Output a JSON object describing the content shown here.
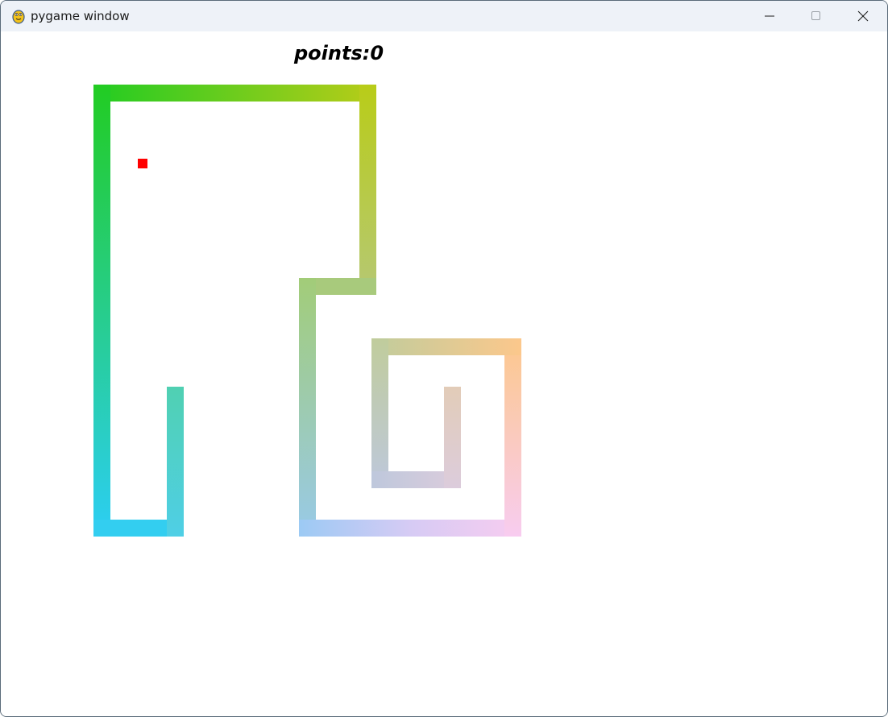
{
  "window": {
    "title": "pygame window",
    "icon": "pygame-snake-icon",
    "controls": [
      "minimize-icon",
      "maximize-icon",
      "close-icon"
    ]
  },
  "game": {
    "score_text": "points:0",
    "snake_colors": {
      "green": "#22cc22",
      "yellow": "#b8cc18",
      "cyan": "#2cd0f4",
      "orange": "#fcc88c",
      "pink": "#f8ccf0"
    },
    "food_color": "#ff0000"
  }
}
